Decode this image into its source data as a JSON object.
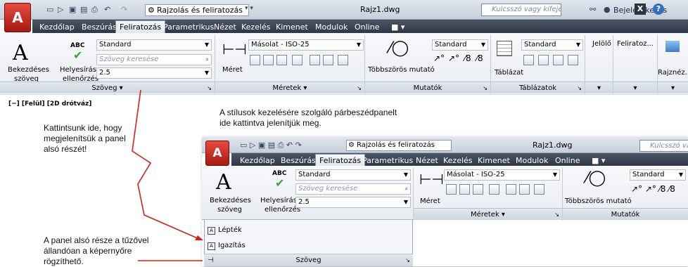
{
  "main": {
    "qat_workspace": "Rajzolás és feliratozás",
    "title": "Rajz1.dwg",
    "search_placeholder": "Kulcsszó vagy kifejezés",
    "login": "Bejelentkezés",
    "help": "?",
    "tabs": [
      "Kezdőlap",
      "Beszúrás",
      "Feliratozás",
      "Parametrikus",
      "Nézet",
      "Kezelés",
      "Kimenet",
      "Modulok",
      "Online"
    ],
    "text_panel": {
      "big_label1": "Bekezdéses",
      "big_label2": "szöveg",
      "spell_label1": "Helyesírás-",
      "spell_label2": "ellenőrzés",
      "abc": "ABC",
      "style_value": "Standard",
      "find_placeholder": "Szöveg keresése",
      "height_value": "2.5",
      "footer": "Szöveg"
    },
    "dim_panel": {
      "big_label": "Méret",
      "style_value": "Másolat - ISO-25",
      "footer": "Méretek"
    },
    "leader_panel": {
      "big_label": "Többszörös mutató",
      "style_value": "Standard",
      "footer": "Mutatók"
    },
    "table_panel": {
      "big_label": "Táblázat",
      "style_value": "Standard",
      "footer": "Táblázatok"
    },
    "jelolo": "Jelölő",
    "feliratoz": "Feliratoz...",
    "rajznez": "Rajznéz...",
    "viewport_label": "[−] [Felül] [2D drótváz]"
  },
  "notes": {
    "top_note_line1": "A stílusok kezelésére szolgáló párbeszédpanelt",
    "top_note_line2": "ide kattintva jelenítjük meg.",
    "left_note_line1": "Kattintsunk ide, hogy",
    "left_note_line2": "megjelenítsük a panel",
    "left_note_line3": "alsó részét!",
    "bottom_note_line1": "A panel alsó része a tűzővel",
    "bottom_note_line2": "állandóan a képernyőre",
    "bottom_note_line3": "rögzíthető."
  },
  "inner": {
    "qat_workspace": "Rajzolás és feliratozás",
    "title": "Rajz1.dwg",
    "search_placeholder": "Kulcsszó vagy kifej",
    "tabs": [
      "Kezdőlap",
      "Beszúrás",
      "Feliratozás",
      "Parametrikus",
      "Nézet",
      "Kezelés",
      "Kimenet",
      "Modulok",
      "Online"
    ],
    "text_panel": {
      "big_label1": "Bekezdéses",
      "big_label2": "szöveg",
      "spell_label1": "Helyesírás-",
      "spell_label2": "ellenőrzés",
      "abc": "ABC",
      "style_value": "Standard",
      "find_placeholder": "Szöveg keresése",
      "height_value": "2.5",
      "scale_item": "Lépték",
      "justify_item": "Igazítás",
      "footer": "Szöveg"
    },
    "dim_panel": {
      "big_label": "Méret",
      "style_value": "Másolat - ISO-25",
      "footer": "Méretek"
    },
    "leader_panel": {
      "big_label": "Többszörös mutató",
      "style_value": "Standard",
      "footer": "Mutatók"
    }
  },
  "colors": {
    "annotation_line": "#d42020",
    "tab_dark": "#38414f",
    "logo_red": "#c8281c"
  }
}
